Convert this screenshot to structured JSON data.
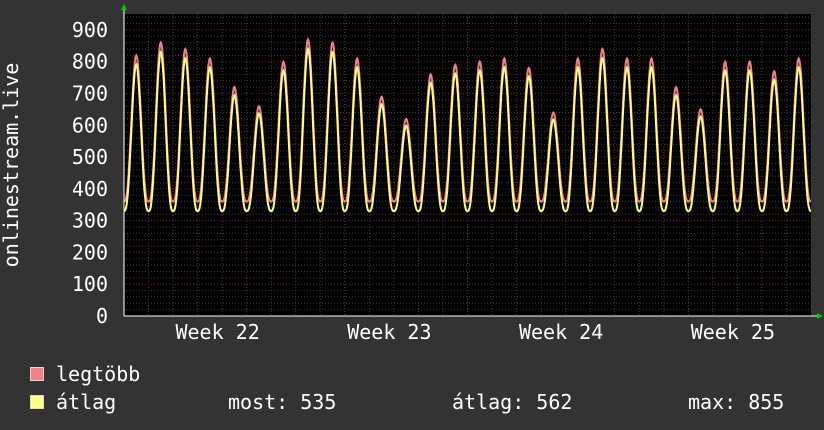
{
  "chart_data": {
    "type": "line",
    "ylabel": "onlinestream.live",
    "ylim": [
      0,
      950
    ],
    "yticks": [
      0,
      100,
      200,
      300,
      400,
      500,
      600,
      700,
      800,
      900
    ],
    "x_week_labels": [
      "Week 22",
      "Week 23",
      "Week 24",
      "Week 25"
    ],
    "x_unit": "day",
    "x_range": [
      0,
      28
    ],
    "daily_peaks_max": [
      820,
      860,
      840,
      810,
      720,
      660,
      800,
      870,
      860,
      810,
      690,
      620,
      760,
      790,
      800,
      810,
      780,
      640,
      810,
      840,
      810,
      810,
      720,
      650,
      800,
      800,
      770,
      810
    ],
    "series": [
      {
        "name": "legtöbb",
        "color": "#f47f86",
        "trough": 360,
        "peak_ratio": 1.0
      },
      {
        "name": "átlag",
        "color": "#ffff80",
        "trough": 330,
        "peak_ratio": 0.965
      }
    ],
    "grid": true
  },
  "legend": {
    "max_label": "legtöbb",
    "avg_label": "átlag",
    "max_color": "#f47f86",
    "avg_color": "#ffff80"
  },
  "stats": {
    "current": "most:  535",
    "average": "átlag:  562",
    "maximum": "max:  855"
  }
}
